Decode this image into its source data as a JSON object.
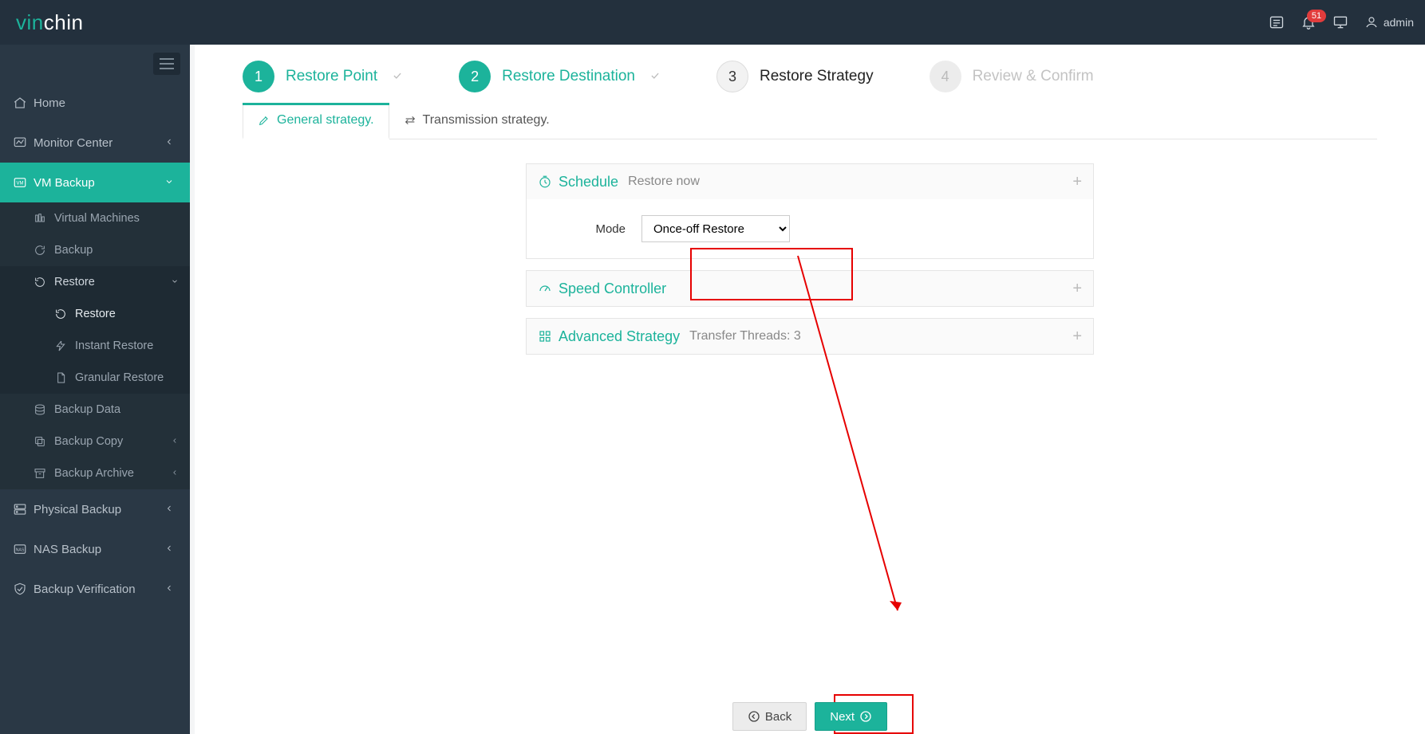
{
  "brand": {
    "pre": "vin",
    "post": "chin"
  },
  "topbar": {
    "notif_count": "51",
    "user": "admin"
  },
  "sidebar": {
    "items": [
      {
        "label": "Home"
      },
      {
        "label": "Monitor Center"
      },
      {
        "label": "VM Backup"
      },
      {
        "label": "Physical Backup"
      },
      {
        "label": "NAS Backup"
      },
      {
        "label": "Backup Verification"
      }
    ],
    "vm_backup": {
      "virtual_machines": "Virtual Machines",
      "backup": "Backup",
      "restore": "Restore",
      "restore_sub": {
        "restore": "Restore",
        "instant": "Instant Restore",
        "granular": "Granular Restore"
      },
      "backup_data": "Backup Data",
      "backup_copy": "Backup Copy",
      "backup_archive": "Backup Archive"
    }
  },
  "wizard": {
    "steps": [
      {
        "n": "1",
        "title": "Restore Point"
      },
      {
        "n": "2",
        "title": "Restore Destination"
      },
      {
        "n": "3",
        "title": "Restore Strategy"
      },
      {
        "n": "4",
        "title": "Review & Confirm"
      }
    ]
  },
  "tabs": {
    "general": "General strategy.",
    "transmission": "Transmission strategy."
  },
  "schedule": {
    "title": "Schedule",
    "summary": "Restore now",
    "mode_label": "Mode",
    "mode_value": "Once-off Restore"
  },
  "speed": {
    "title": "Speed Controller"
  },
  "advanced": {
    "title": "Advanced Strategy",
    "summary": "Transfer Threads: 3"
  },
  "buttons": {
    "back": "Back",
    "next": "Next"
  }
}
